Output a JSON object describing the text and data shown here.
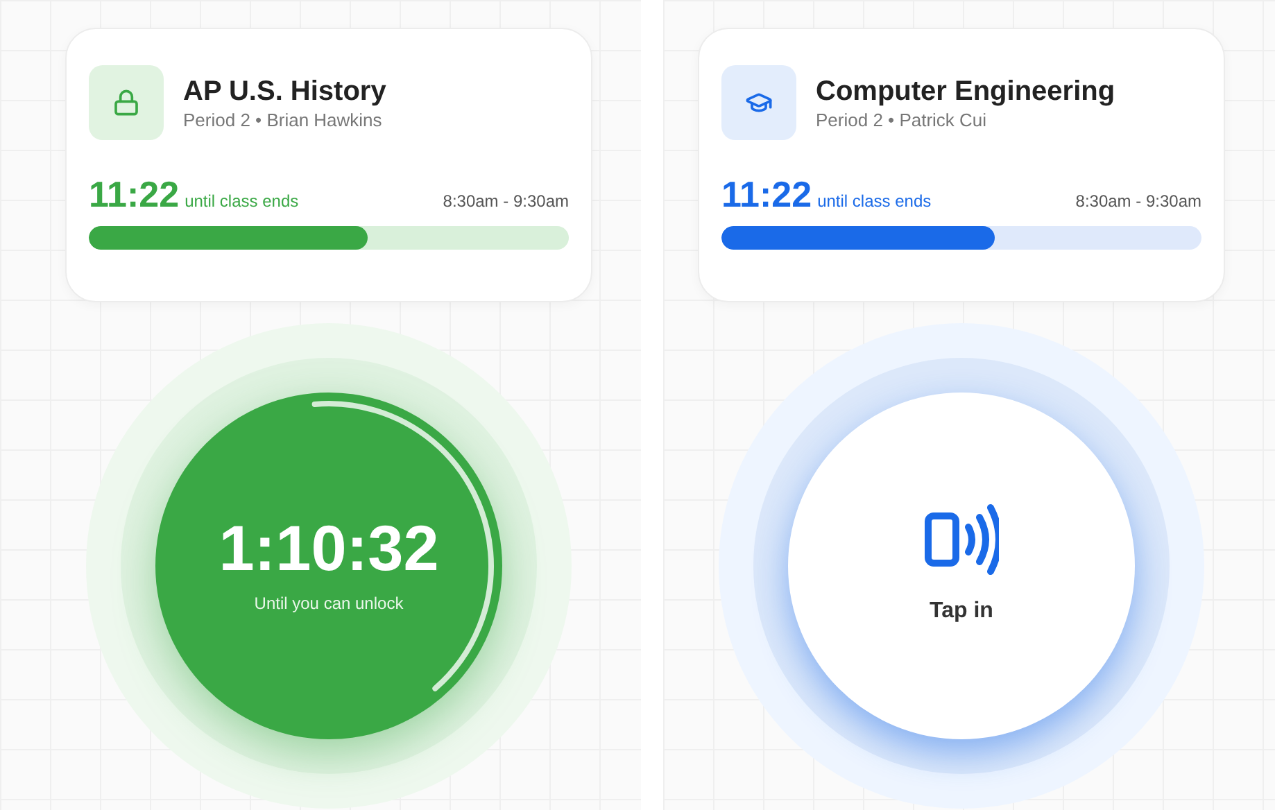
{
  "screens": [
    {
      "kind": "locked",
      "course": "AP U.S. History",
      "subtitle": "Period 2 • Brian Hawkins",
      "countdown": "11:22",
      "countdown_label": "until class ends",
      "time_range": "8:30am - 9:30am",
      "level": 0.58,
      "center": {
        "time": "1:10:32",
        "label": "Until you can unlock",
        "level": 0.4
      }
    },
    {
      "kind": "tap",
      "course": "Computer Engineering",
      "subtitle": "Period 2 • Patrick Cui",
      "countdown": "11:22",
      "countdown_label": "until class ends",
      "time_range": "8:30am - 9:30am",
      "level": 0.57,
      "center": {
        "label": "Tap in"
      }
    }
  ]
}
